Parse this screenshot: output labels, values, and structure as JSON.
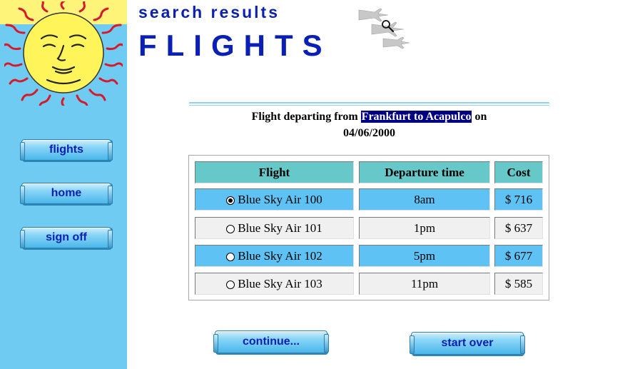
{
  "header": {
    "subtitle": "search results",
    "title": "FLIGHTS"
  },
  "nav": {
    "flights": "flights",
    "home": "home",
    "sign_off": "sign off"
  },
  "summary": {
    "prefix": "Flight departing from",
    "route": "Frankfurt to Acapulco",
    "suffix": "on",
    "date": "04/06/2000"
  },
  "table": {
    "headers": [
      "Flight",
      "Departure time",
      "Cost"
    ],
    "rows": [
      {
        "flight": "Blue Sky Air 100",
        "time": "8am",
        "cost": "$ 716",
        "selected": true
      },
      {
        "flight": "Blue Sky Air 101",
        "time": "1pm",
        "cost": "$ 637",
        "selected": false
      },
      {
        "flight": "Blue Sky Air 102",
        "time": "5pm",
        "cost": "$ 677",
        "selected": false
      },
      {
        "flight": "Blue Sky Air 103",
        "time": "11pm",
        "cost": "$ 585",
        "selected": false
      }
    ]
  },
  "actions": {
    "continue": "continue...",
    "start_over": "start over"
  },
  "icons": {
    "logo": "sun-face-logo",
    "decoration": "airplanes-magnifier-icon"
  },
  "colors": {
    "sidebar": "#6fcbf2",
    "sidebar_top": "#fff47a",
    "heading": "#0a1fb4",
    "header_cell": "#66c8c8",
    "row_highlight": "#5fc2f5",
    "row_plain": "#f0f0f0",
    "route_highlight": "#000080"
  }
}
